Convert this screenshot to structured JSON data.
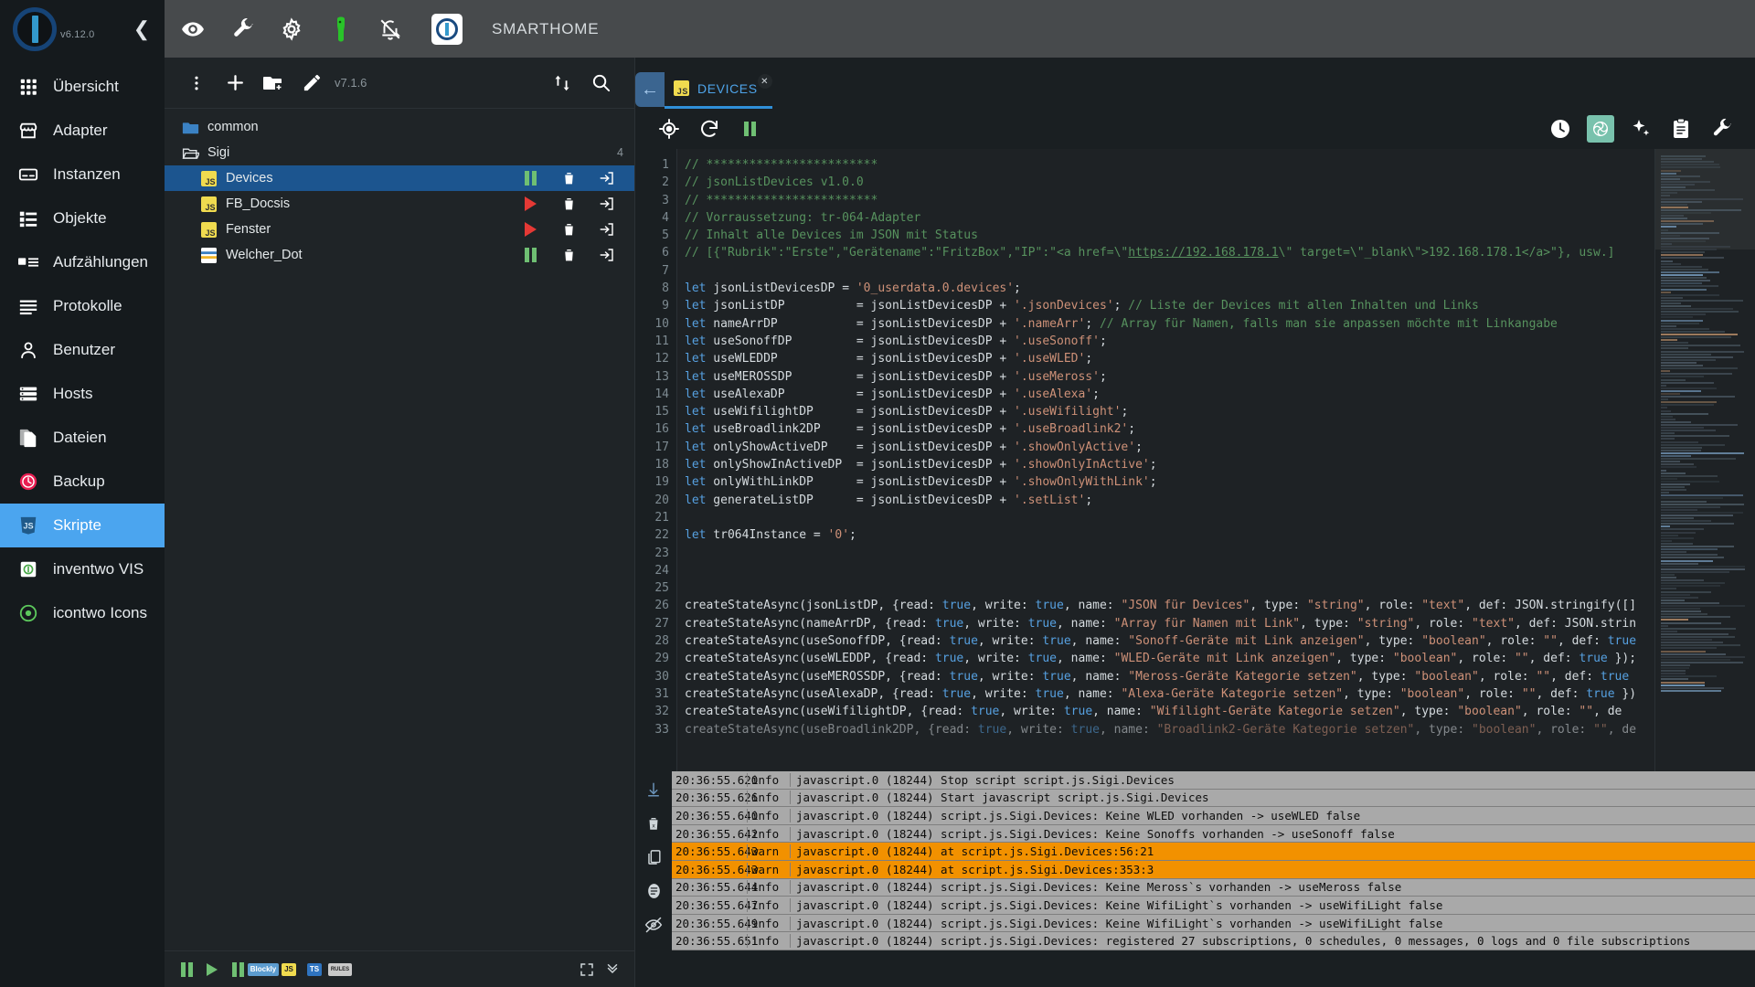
{
  "sidebar": {
    "version": "v6.12.0",
    "collapse_icon": "chevron-left-icon",
    "items": [
      {
        "label": "Übersicht",
        "icon": "grid-icon",
        "active": false
      },
      {
        "label": "Adapter",
        "icon": "store-icon",
        "active": false
      },
      {
        "label": "Instanzen",
        "icon": "instances-icon",
        "active": false
      },
      {
        "label": "Objekte",
        "icon": "list-icon",
        "active": false
      },
      {
        "label": "Aufzählungen",
        "icon": "enum-icon",
        "active": false
      },
      {
        "label": "Protokolle",
        "icon": "log-icon",
        "active": false
      },
      {
        "label": "Benutzer",
        "icon": "user-icon",
        "active": false
      },
      {
        "label": "Hosts",
        "icon": "hosts-icon",
        "active": false
      },
      {
        "label": "Dateien",
        "icon": "files-icon",
        "active": false
      },
      {
        "label": "Backup",
        "icon": "backup-icon",
        "active": false
      },
      {
        "label": "Skripte",
        "icon": "js-icon",
        "active": true
      },
      {
        "label": "inventwo VIS",
        "icon": "vis-icon",
        "active": false
      },
      {
        "label": "icontwo Icons",
        "icon": "icons-icon",
        "active": false
      }
    ]
  },
  "topbar": {
    "title": "SMARTHOME",
    "icons": [
      "eye-icon",
      "wrench-icon",
      "gear-icon",
      "robot-green-icon",
      "bell-off-icon"
    ]
  },
  "tree": {
    "toolbar": {
      "more_icon": "more-vertical-icon",
      "add_icon": "plus-icon",
      "new_folder_icon": "new-folder-icon",
      "edit_icon": "pencil-icon",
      "version": "v7.1.6",
      "sort_icon": "sort-icon",
      "search_icon": "search-icon"
    },
    "rows": [
      {
        "label": "common",
        "type": "folder",
        "level": 1,
        "selected": false,
        "count": "",
        "state": ""
      },
      {
        "label": "Sigi",
        "type": "folder-open",
        "level": 1,
        "selected": false,
        "count": "4",
        "state": ""
      },
      {
        "label": "Devices",
        "type": "js",
        "level": 2,
        "selected": true,
        "count": "",
        "state": "running"
      },
      {
        "label": "FB_Docsis",
        "type": "js",
        "level": 2,
        "selected": false,
        "count": "",
        "state": "stopped"
      },
      {
        "label": "Fenster",
        "type": "js",
        "level": 2,
        "selected": false,
        "count": "",
        "state": "stopped"
      },
      {
        "label": "Welcher_Dot",
        "type": "ts",
        "level": 2,
        "selected": false,
        "count": "",
        "state": "running"
      }
    ],
    "row_action_icons": [
      "pause-icon",
      "delete-icon",
      "export-icon"
    ],
    "bottom": {
      "icons": [
        "pause-icon",
        "play-icon",
        "pause2-icon",
        "blockly-badge",
        "js-badge",
        "ts-badge",
        "rules-badge",
        "expand-icon",
        "collapse-icon"
      ],
      "badges": {
        "blockly": "Blockly",
        "js": "JS",
        "ts": "TS",
        "rules": "RULES"
      }
    }
  },
  "editor": {
    "back_icon": "arrow-left-icon",
    "tab": {
      "label": "DEVICES",
      "icon": "js-icon",
      "close_icon": "close-icon"
    },
    "toolbar_left": [
      "locate-icon",
      "reload-icon",
      "pause-icon"
    ],
    "toolbar_right": [
      "clock-icon",
      "openai-icon",
      "sparkle-icon",
      "clipboard-icon",
      "wrench-icon"
    ],
    "lines": [
      {
        "n": 1,
        "html": "<span class='cm'>// ************************</span>"
      },
      {
        "n": 2,
        "html": "<span class='cm'>// jsonListDevices v1.0.0</span>"
      },
      {
        "n": 3,
        "html": "<span class='cm'>// ************************</span>"
      },
      {
        "n": 4,
        "html": "<span class='cm'>// Vorraussetzung: tr-064-Adapter</span>"
      },
      {
        "n": 5,
        "html": "<span class='cm'>// Inhalt alle Devices im JSON mit Status</span>"
      },
      {
        "n": 6,
        "html": "<span class='cm'>// [{\"Rubrik\":\"Erste\",\"Gerätename\":\"FritzBox\",\"IP\":\"&lt;a href=\\\"</span><span class='lnk'>https://192.168.178.1</span><span class='cm'>\\\" target=\\\"_blank\\\"&gt;192.168.178.1&lt;/a&gt;\"}, usw.]</span>"
      },
      {
        "n": 7,
        "html": ""
      },
      {
        "n": 8,
        "html": "<span class='tk'>let</span> jsonListDevicesDP = <span class='st'>'0_userdata.0.devices'</span>;"
      },
      {
        "n": 9,
        "html": "<span class='tk'>let</span> jsonListDP          = jsonListDevicesDP + <span class='st'>'.jsonDevices'</span>; <span class='cm'>// Liste der Devices mit allen Inhalten und Links</span>"
      },
      {
        "n": 10,
        "html": "<span class='tk'>let</span> nameArrDP           = jsonListDevicesDP + <span class='st'>'.nameArr'</span>; <span class='cm'>// Array für Namen, falls man sie anpassen möchte mit Linkangabe</span>"
      },
      {
        "n": 11,
        "html": "<span class='tk'>let</span> useSonoffDP         = jsonListDevicesDP + <span class='st'>'.useSonoff'</span>;"
      },
      {
        "n": 12,
        "html": "<span class='tk'>let</span> useWLEDDP           = jsonListDevicesDP + <span class='st'>'.useWLED'</span>;"
      },
      {
        "n": 13,
        "html": "<span class='tk'>let</span> useMEROSSDP         = jsonListDevicesDP + <span class='st'>'.useMeross'</span>;"
      },
      {
        "n": 14,
        "html": "<span class='tk'>let</span> useAlexaDP          = jsonListDevicesDP + <span class='st'>'.useAlexa'</span>;"
      },
      {
        "n": 15,
        "html": "<span class='tk'>let</span> useWifilightDP      = jsonListDevicesDP + <span class='st'>'.useWifilight'</span>;"
      },
      {
        "n": 16,
        "html": "<span class='tk'>let</span> useBroadlink2DP     = jsonListDevicesDP + <span class='st'>'.useBroadlink2'</span>;"
      },
      {
        "n": 17,
        "html": "<span class='tk'>let</span> onlyShowActiveDP    = jsonListDevicesDP + <span class='st'>'.showOnlyActive'</span>;"
      },
      {
        "n": 18,
        "html": "<span class='tk'>let</span> onlyShowInActiveDP  = jsonListDevicesDP + <span class='st'>'.showOnlyInActive'</span>;"
      },
      {
        "n": 19,
        "html": "<span class='tk'>let</span> onlyWithLinkDP      = jsonListDevicesDP + <span class='st'>'.showOnlyWithLink'</span>;"
      },
      {
        "n": 20,
        "html": "<span class='tk'>let</span> generateListDP      = jsonListDevicesDP + <span class='st'>'.setList'</span>;"
      },
      {
        "n": 21,
        "html": ""
      },
      {
        "n": 22,
        "html": "<span class='tk'>let</span> tr064Instance = <span class='st'>'0'</span>;"
      },
      {
        "n": 23,
        "html": ""
      },
      {
        "n": 24,
        "html": ""
      },
      {
        "n": 25,
        "html": ""
      },
      {
        "n": 26,
        "html": "createStateAsync(jsonListDP, {read: <span class='tk'>true</span>, write: <span class='tk'>true</span>, name: <span class='st'>\"JSON für Devices\"</span>, type: <span class='st'>\"string\"</span>, role: <span class='st'>\"text\"</span>, def: JSON.stringify([]"
      },
      {
        "n": 27,
        "html": "createStateAsync(nameArrDP, {read: <span class='tk'>true</span>, write: <span class='tk'>true</span>, name: <span class='st'>\"Array für Namen mit Link\"</span>, type: <span class='st'>\"string\"</span>, role: <span class='st'>\"text\"</span>, def: JSON.strin"
      },
      {
        "n": 28,
        "html": "createStateAsync(useSonoffDP, {read: <span class='tk'>true</span>, write: <span class='tk'>true</span>, name: <span class='st'>\"Sonoff-Geräte mit Link anzeigen\"</span>, type: <span class='st'>\"boolean\"</span>, role: <span class='st'>\"\"</span>, def: <span class='tk'>true</span>"
      },
      {
        "n": 29,
        "html": "createStateAsync(useWLEDDP, {read: <span class='tk'>true</span>, write: <span class='tk'>true</span>, name: <span class='st'>\"WLED-Geräte mit Link anzeigen\"</span>, type: <span class='st'>\"boolean\"</span>, role: <span class='st'>\"\"</span>, def: <span class='tk'>true</span> });"
      },
      {
        "n": 30,
        "html": "createStateAsync(useMEROSSDP, {read: <span class='tk'>true</span>, write: <span class='tk'>true</span>, name: <span class='st'>\"Meross-Geräte Kategorie setzen\"</span>, type: <span class='st'>\"boolean\"</span>, role: <span class='st'>\"\"</span>, def: <span class='tk'>true</span>"
      },
      {
        "n": 31,
        "html": "createStateAsync(useAlexaDP, {read: <span class='tk'>true</span>, write: <span class='tk'>true</span>, name: <span class='st'>\"Alexa-Geräte Kategorie setzen\"</span>, type: <span class='st'>\"boolean\"</span>, role: <span class='st'>\"\"</span>, def: <span class='tk'>true</span> })"
      },
      {
        "n": 32,
        "html": "createStateAsync(useWifilightDP, {read: <span class='tk'>true</span>, write: <span class='tk'>true</span>, name: <span class='st'>\"Wifilight-Geräte Kategorie setzen\"</span>, type: <span class='st'>\"boolean\"</span>, role: <span class='st'>\"\"</span>, de"
      },
      {
        "n": 33,
        "html": "<span style='opacity:.55'>createStateAsync(useBroadlink2DP, {read: <span class='tk'>true</span>, write: <span class='tk'>true</span>, name: <span class='st'>\"Broadlink2-Geräte Kategorie setzen\"</span>, type: <span class='st'>\"boolean\"</span>, role: <span class='st'>\"\"</span>, de</span>"
      }
    ]
  },
  "log": {
    "tool_icons": [
      "scroll-down-icon",
      "clear-icon",
      "copy-icon",
      "layout-icon",
      "hide-icon"
    ],
    "rows": [
      {
        "time": "20:36:55.620",
        "sev": "info",
        "msg": "javascript.0 (18244) Stop script script.js.Sigi.Devices"
      },
      {
        "time": "20:36:55.626",
        "sev": "info",
        "msg": "javascript.0 (18244) Start javascript script.js.Sigi.Devices"
      },
      {
        "time": "20:36:55.640",
        "sev": "info",
        "msg": "javascript.0 (18244) script.js.Sigi.Devices: Keine WLED vorhanden -> useWLED false"
      },
      {
        "time": "20:36:55.642",
        "sev": "info",
        "msg": "javascript.0 (18244) script.js.Sigi.Devices: Keine Sonoffs vorhanden -> useSonoff false"
      },
      {
        "time": "20:36:55.643",
        "sev": "warn",
        "msg": "javascript.0 (18244) at script.js.Sigi.Devices:56:21"
      },
      {
        "time": "20:36:55.643",
        "sev": "warn",
        "msg": "javascript.0 (18244) at script.js.Sigi.Devices:353:3"
      },
      {
        "time": "20:36:55.644",
        "sev": "info",
        "msg": "javascript.0 (18244) script.js.Sigi.Devices: Keine Meross`s vorhanden -> useMeross false"
      },
      {
        "time": "20:36:55.647",
        "sev": "info",
        "msg": "javascript.0 (18244) script.js.Sigi.Devices: Keine WifiLight`s vorhanden -> useWifiLight false"
      },
      {
        "time": "20:36:55.649",
        "sev": "info",
        "msg": "javascript.0 (18244) script.js.Sigi.Devices: Keine WifiLight`s vorhanden -> useWifiLight false"
      },
      {
        "time": "20:36:55.651",
        "sev": "info",
        "msg": "javascript.0 (18244) script.js.Sigi.Devices: registered 27 subscriptions, 0 schedules, 0 messages, 0 logs and 0 file subscriptions"
      }
    ]
  },
  "colors": {
    "accent": "#4ba5ef",
    "warn": "#f29100",
    "js_yellow": "#f0db4f",
    "green": "#6fbf73",
    "red": "#e53935"
  }
}
